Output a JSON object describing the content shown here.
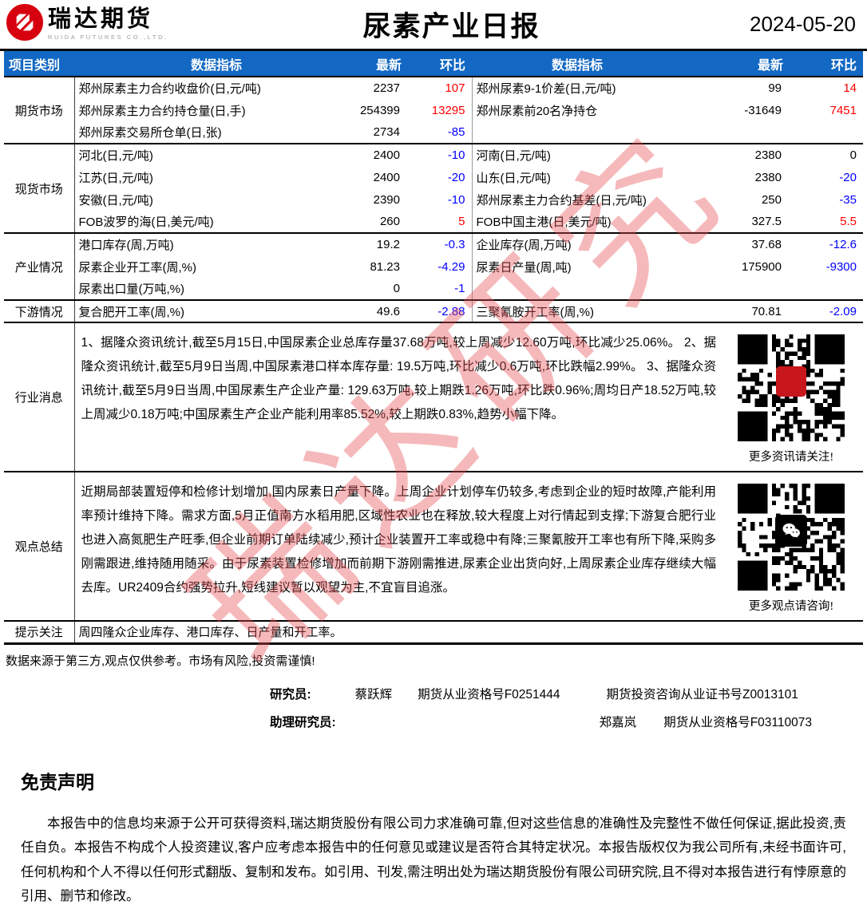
{
  "meta": {
    "title": "尿素产业日报",
    "date": "2024-05-20"
  },
  "brand": {
    "name": "瑞达期货",
    "subtitle": "RUIDA FUTURES CO.,LTD."
  },
  "colors": {
    "header_bg": "#1268C3",
    "up": "#ff0000",
    "down": "#0000ff",
    "brand_red": "#D7000F"
  },
  "watermark": {
    "text": "瑞达研究"
  },
  "table": {
    "headers": [
      "项目类别",
      "数据指标",
      "最新",
      "环比",
      "数据指标",
      "最新",
      "环比"
    ],
    "groups": [
      {
        "category": "期货市场",
        "rows": [
          {
            "i1": "郑州尿素主力合约收盘价(日,元/吨)",
            "v1": "2237",
            "c1": "107",
            "i2": "郑州尿素9-1价差(日,元/吨)",
            "v2": "99",
            "c2": "14"
          },
          {
            "i1": "郑州尿素主力合约持仓量(日,手)",
            "v1": "254399",
            "c1": "13295",
            "i2": "郑州尿素前20名净持仓",
            "v2": "-31649",
            "c2": "7451"
          },
          {
            "i1": "郑州尿素交易所仓单(日,张)",
            "v1": "2734",
            "c1": "-85",
            "i2": "",
            "v2": "",
            "c2": ""
          }
        ]
      },
      {
        "category": "现货市场",
        "rows": [
          {
            "i1": "河北(日,元/吨)",
            "v1": "2400",
            "c1": "-10",
            "i2": "河南(日,元/吨)",
            "v2": "2380",
            "c2": "0"
          },
          {
            "i1": "江苏(日,元/吨)",
            "v1": "2400",
            "c1": "-20",
            "i2": "山东(日,元/吨)",
            "v2": "2380",
            "c2": "-20"
          },
          {
            "i1": "安徽(日,元/吨)",
            "v1": "2390",
            "c1": "-10",
            "i2": "郑州尿素主力合约基差(日,元/吨)",
            "v2": "250",
            "c2": "-35"
          },
          {
            "i1": "FOB波罗的海(日,美元/吨)",
            "v1": "260",
            "c1": "5",
            "i2": "FOB中国主港(日,美元/吨)",
            "v2": "327.5",
            "c2": "5.5"
          }
        ]
      },
      {
        "category": "产业情况",
        "rows": [
          {
            "i1": "港口库存(周,万吨)",
            "v1": "19.2",
            "c1": "-0.3",
            "i2": "企业库存(周,万吨)",
            "v2": "37.68",
            "c2": "-12.6"
          },
          {
            "i1": "尿素企业开工率(周,%)",
            "v1": "81.23",
            "c1": "-4.29",
            "i2": "尿素日产量(周,吨)",
            "v2": "175900",
            "c2": "-9300"
          },
          {
            "i1": "尿素出口量(万吨,%)",
            "v1": "0",
            "c1": "-1",
            "i2": "",
            "v2": "",
            "c2": ""
          }
        ]
      },
      {
        "category": "下游情况",
        "rows": [
          {
            "i1": "复合肥开工率(周,%)",
            "v1": "49.6",
            "c1": "-2.88",
            "i2": "三聚氰胺开工率(周,%)",
            "v2": "70.81",
            "c2": "-2.09"
          }
        ]
      }
    ]
  },
  "news": {
    "category": "行业消息",
    "text": "1、据隆众资讯统计,截至5月15日,中国尿素企业总库存量37.68万吨,较上周减少12.60万吨,环比减少25.06%。 2、据隆众资讯统计,截至5月9日当周,中国尿素港口样本库存量: 19.5万吨,环比减少0.6万吨,环比跌幅2.99%。 3、据隆众资讯统计,截至5月9日当周,中国尿素生产企业产量: 129.63万吨,较上期跌1.26万吨,环比跌0.96%;周均日产18.52万吨,较上周减少0.18万吨;中国尿素生产企业产能利用率85.52%,较上期跌0.83%,趋势小幅下降。",
    "qr_caption": "更多资讯请关注!"
  },
  "opinion": {
    "category": "观点总结",
    "text": "近期局部装置短停和检修计划增加,国内尿素日产量下降。上周企业计划停车仍较多,考虑到企业的短时故障,产能利用率预计维持下降。需求方面,5月正值南方水稻用肥,区域性农业也在释放,较大程度上对行情起到支撑;下游复合肥行业也进入高氮肥生产旺季,但企业前期订单陆续减少,预计企业装置开工率或稳中有降;三聚氰胺开工率也有所下降,采购多刚需跟进,维持随用随采。由于尿素装置检修增加而前期下游刚需推进,尿素企业出货向好,上周尿素企业库存继续大幅去库。UR2409合约强势拉升,短线建议暂以观望为主,不宜盲目追涨。",
    "qr_caption": "更多观点请咨询!"
  },
  "alert": {
    "category": "提示关注",
    "text": "周四隆众企业库存、港口库存、日产量和开工率。"
  },
  "footer": {
    "note": "数据来源于第三方,观点仅供参考。市场有风险,投资需谨慎!",
    "researcher_label": "研究员:",
    "researcher_name": "蔡跃辉",
    "researcher_cert": "期货从业资格号F0251444",
    "researcher_cert2": "期货投资咨询从业证书号Z0013101",
    "assistant_label": "助理研究员:",
    "assistant_name": "郑嘉岚",
    "assistant_cert": "期货从业资格号F03110073"
  },
  "disclaimer": {
    "title": "免责声明",
    "body": "本报告中的信息均来源于公开可获得资料,瑞达期货股份有限公司力求准确可靠,但对这些信息的准确性及完整性不做任何保证,据此投资,责任自负。本报告不构成个人投资建议,客户应考虑本报告中的任何意见或建议是否符合其特定状况。本报告版权仅为我公司所有,未经书面许可,任何机构和个人不得以任何形式翻版、复制和发布。如引用、刊发,需注明出处为瑞达期货股份有限公司研究院,且不得对本报告进行有悖原意的引用、删节和修改。"
  }
}
